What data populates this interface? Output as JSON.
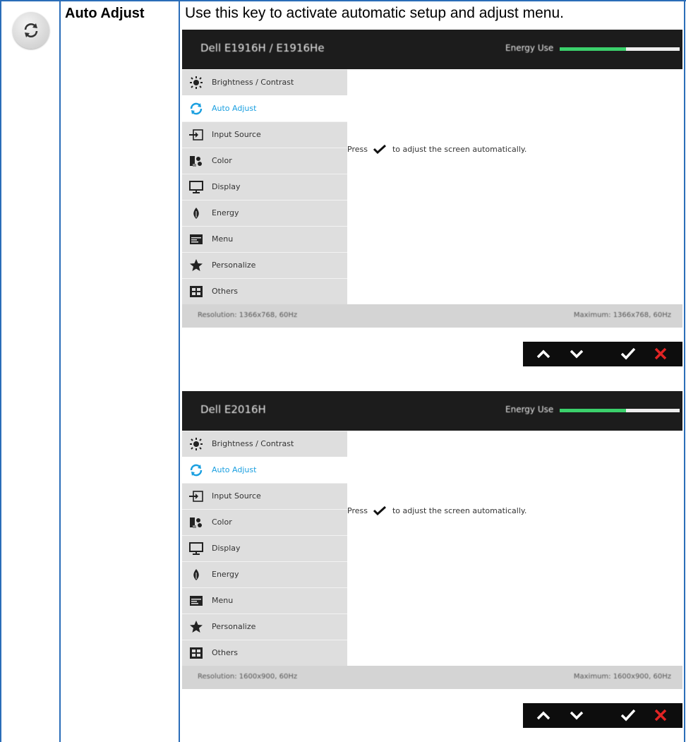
{
  "row": {
    "feature": "Auto Adjust",
    "description": "Use this key to activate automatic setup and adjust menu."
  },
  "osd_screens": [
    {
      "model": "Dell E1916H / E1916He",
      "energy_label": "Energy Use",
      "energy_level": 0.55,
      "menu_items": [
        {
          "icon": "brightness-icon",
          "label": "Brightness / Contrast"
        },
        {
          "icon": "auto-adjust-icon",
          "label": "Auto Adjust",
          "selected": true
        },
        {
          "icon": "input-source-icon",
          "label": "Input Source"
        },
        {
          "icon": "color-icon",
          "label": "Color"
        },
        {
          "icon": "display-icon",
          "label": "Display"
        },
        {
          "icon": "energy-icon",
          "label": "Energy"
        },
        {
          "icon": "menu-icon",
          "label": "Menu"
        },
        {
          "icon": "star-icon",
          "label": "Personalize"
        },
        {
          "icon": "others-icon",
          "label": "Others"
        }
      ],
      "message_before": "Press",
      "message_after": "to adjust the screen automatically.",
      "resolution": "Resolution: 1366x768, 60Hz",
      "maximum": "Maximum: 1366x768, 60Hz"
    },
    {
      "model": "Dell E2016H",
      "energy_label": "Energy Use",
      "energy_level": 0.55,
      "menu_items": [
        {
          "icon": "brightness-icon",
          "label": "Brightness / Contrast"
        },
        {
          "icon": "auto-adjust-icon",
          "label": "Auto Adjust",
          "selected": true
        },
        {
          "icon": "input-source-icon",
          "label": "Input Source"
        },
        {
          "icon": "color-icon",
          "label": "Color"
        },
        {
          "icon": "display-icon",
          "label": "Display"
        },
        {
          "icon": "energy-icon",
          "label": "Energy"
        },
        {
          "icon": "menu-icon",
          "label": "Menu"
        },
        {
          "icon": "star-icon",
          "label": "Personalize"
        },
        {
          "icon": "others-icon",
          "label": "Others"
        }
      ],
      "message_before": "Press",
      "message_after": "to adjust the screen automatically.",
      "resolution": "Resolution: 1600x900, 60Hz",
      "maximum": "Maximum: 1600x900, 60Hz"
    }
  ],
  "nav_buttons": [
    {
      "icon": "up-arrow-icon"
    },
    {
      "icon": "down-arrow-icon"
    },
    {
      "icon": "checkmark-icon"
    },
    {
      "icon": "close-icon"
    }
  ],
  "colors": {
    "table_border": "#2a6db8",
    "energy_bar": "#3bd06b",
    "selected_item": "#1a9fe0",
    "exit_button": "#e02424"
  }
}
